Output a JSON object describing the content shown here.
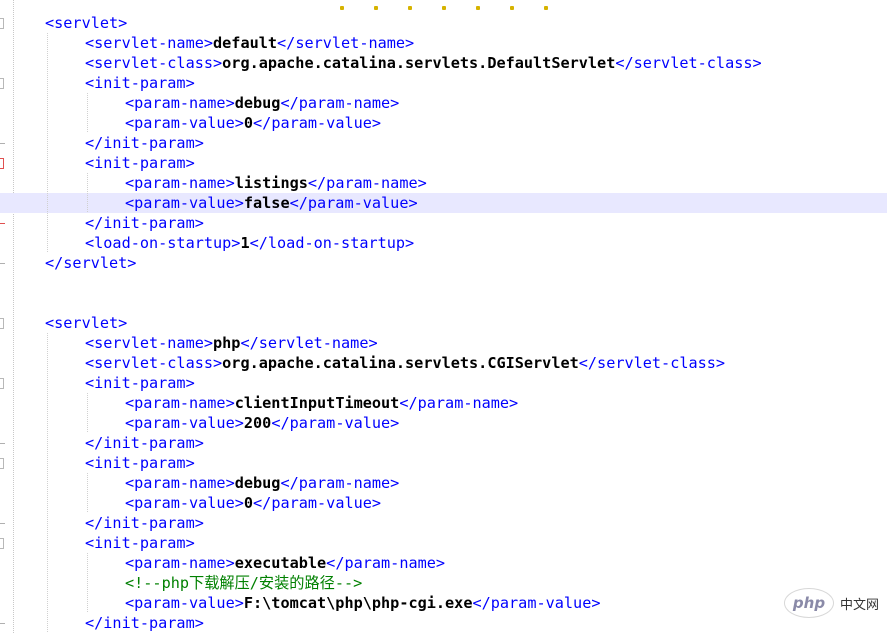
{
  "editor": {
    "current_line_index": 10,
    "lines": [
      {
        "indent": 0,
        "open": "",
        "value": "",
        "close": "",
        "comment": ""
      },
      {
        "indent": 1,
        "open": "<servlet>",
        "value": "",
        "close": "",
        "comment": ""
      },
      {
        "indent": 2,
        "open": "<servlet-name>",
        "value": "default",
        "close": "</servlet-name>",
        "comment": ""
      },
      {
        "indent": 2,
        "open": "<servlet-class>",
        "value": "org.apache.catalina.servlets.DefaultServlet",
        "close": "</servlet-class>",
        "comment": ""
      },
      {
        "indent": 2,
        "open": "<init-param>",
        "value": "",
        "close": "",
        "comment": ""
      },
      {
        "indent": 3,
        "open": "<param-name>",
        "value": "debug",
        "close": "</param-name>",
        "comment": ""
      },
      {
        "indent": 3,
        "open": "<param-value>",
        "value": "0",
        "close": "</param-value>",
        "comment": ""
      },
      {
        "indent": 2,
        "open": "</init-param>",
        "value": "",
        "close": "",
        "comment": ""
      },
      {
        "indent": 2,
        "open": "<init-param>",
        "value": "",
        "close": "",
        "comment": ""
      },
      {
        "indent": 3,
        "open": "<param-name>",
        "value": "listings",
        "close": "</param-name>",
        "comment": ""
      },
      {
        "indent": 3,
        "open": "<param-value>",
        "value": "false",
        "close": "</param-value>",
        "comment": ""
      },
      {
        "indent": 2,
        "open": "</init-param>",
        "value": "",
        "close": "",
        "comment": ""
      },
      {
        "indent": 2,
        "open": "<load-on-startup>",
        "value": "1",
        "close": "</load-on-startup>",
        "comment": ""
      },
      {
        "indent": 1,
        "open": "</servlet>",
        "value": "",
        "close": "",
        "comment": ""
      },
      {
        "indent": 0,
        "open": "",
        "value": "",
        "close": "",
        "comment": ""
      },
      {
        "indent": 0,
        "open": "",
        "value": "",
        "close": "",
        "comment": ""
      },
      {
        "indent": 1,
        "open": "<servlet>",
        "value": "",
        "close": "",
        "comment": ""
      },
      {
        "indent": 2,
        "open": "<servlet-name>",
        "value": "php",
        "close": "</servlet-name>",
        "comment": ""
      },
      {
        "indent": 2,
        "open": "<servlet-class>",
        "value": "org.apache.catalina.servlets.CGIServlet",
        "close": "</servlet-class>",
        "comment": ""
      },
      {
        "indent": 2,
        "open": "<init-param>",
        "value": "",
        "close": "",
        "comment": ""
      },
      {
        "indent": 3,
        "open": "<param-name>",
        "value": "clientInputTimeout",
        "close": "</param-name>",
        "comment": ""
      },
      {
        "indent": 3,
        "open": "<param-value>",
        "value": "200",
        "close": "</param-value>",
        "comment": ""
      },
      {
        "indent": 2,
        "open": "</init-param>",
        "value": "",
        "close": "",
        "comment": ""
      },
      {
        "indent": 2,
        "open": "<init-param>",
        "value": "",
        "close": "",
        "comment": ""
      },
      {
        "indent": 3,
        "open": "<param-name>",
        "value": "debug",
        "close": "</param-name>",
        "comment": ""
      },
      {
        "indent": 3,
        "open": "<param-value>",
        "value": "0",
        "close": "</param-value>",
        "comment": ""
      },
      {
        "indent": 2,
        "open": "</init-param>",
        "value": "",
        "close": "",
        "comment": ""
      },
      {
        "indent": 2,
        "open": "<init-param>",
        "value": "",
        "close": "",
        "comment": ""
      },
      {
        "indent": 3,
        "open": "<param-name>",
        "value": "executable",
        "close": "</param-name>",
        "comment": ""
      },
      {
        "indent": 3,
        "open": "",
        "value": "",
        "close": "",
        "comment": "<!--php下载解压/安装的路径-->"
      },
      {
        "indent": 3,
        "open": "<param-value>",
        "value": "F:\\tomcat\\php\\php-cgi.exe",
        "close": "</param-value>",
        "comment": ""
      },
      {
        "indent": 2,
        "open": "</init-param>",
        "value": "",
        "close": "",
        "comment": ""
      }
    ]
  },
  "colors": {
    "tag": "#0000ff",
    "value": "#000000",
    "comment": "#008000",
    "current_line": "#e8e8ff"
  },
  "watermark": {
    "logo": "php",
    "text": "中文网"
  }
}
